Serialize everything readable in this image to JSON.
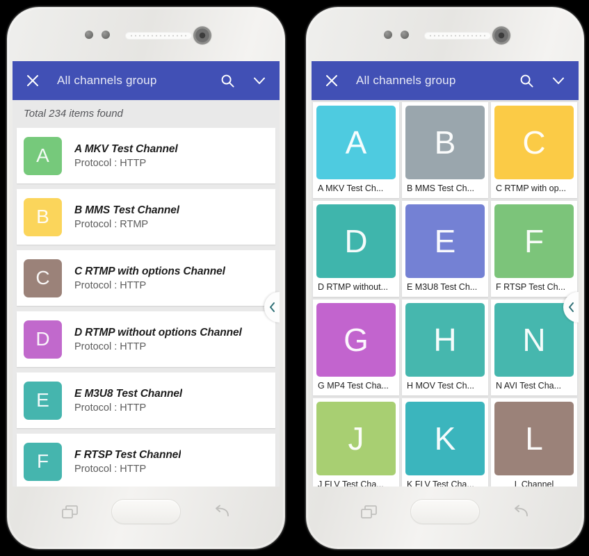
{
  "toolbar": {
    "close_icon": "close-icon",
    "title": "All channels group",
    "search_icon": "search-icon",
    "expand_icon": "chevron-down-icon"
  },
  "list_view": {
    "count_text": "Total 234 items found",
    "protocol_prefix": "Protocol : ",
    "items": [
      {
        "letter": "A",
        "title": "A MKV Test Channel",
        "subtitle": "Protocol : HTTP",
        "protocol": "HTTP",
        "color": "#76c97b"
      },
      {
        "letter": "B",
        "title": "B MMS Test Channel",
        "subtitle": "Protocol : RTMP",
        "protocol": "RTMP",
        "color": "#fbd55b"
      },
      {
        "letter": "C",
        "title": "C RTMP with options Channel",
        "subtitle": "Protocol : HTTP",
        "protocol": "HTTP",
        "color": "#9b8279"
      },
      {
        "letter": "D",
        "title": "D RTMP without options Channel",
        "subtitle": "Protocol : HTTP",
        "protocol": "HTTP",
        "color": "#c169cc"
      },
      {
        "letter": "E",
        "title": "E M3U8 Test Channel",
        "subtitle": "Protocol : HTTP",
        "protocol": "HTTP",
        "color": "#45b5ae"
      },
      {
        "letter": "F",
        "title": "F RTSP Test Channel",
        "subtitle": "Protocol : HTTP",
        "protocol": "HTTP",
        "color": "#45b5ae"
      }
    ]
  },
  "grid_view": {
    "tiles": [
      {
        "letter": "A",
        "label": "A MKV Test Ch...",
        "color": "#4ecbe0",
        "centered": false
      },
      {
        "letter": "B",
        "label": "B MMS Test Ch...",
        "color": "#9aa6ad",
        "centered": false
      },
      {
        "letter": "C",
        "label": "C RTMP with op...",
        "color": "#fbcb46",
        "centered": false
      },
      {
        "letter": "D",
        "label": "D RTMP without...",
        "color": "#3fb5ac",
        "centered": false
      },
      {
        "letter": "E",
        "label": "E M3U8 Test Ch...",
        "color": "#7481d4",
        "centered": false
      },
      {
        "letter": "F",
        "label": "F RTSP Test Ch...",
        "color": "#7cc47a",
        "centered": false
      },
      {
        "letter": "G",
        "label": "G MP4 Test Cha...",
        "color": "#c264ce",
        "centered": false
      },
      {
        "letter": "H",
        "label": "H MOV Test Ch...",
        "color": "#46b7ae",
        "centered": false
      },
      {
        "letter": "N",
        "label": "N AVI Test Cha...",
        "color": "#46b7ae",
        "centered": false
      },
      {
        "letter": "J",
        "label": "J FLV Test Cha...",
        "color": "#a8cf72",
        "centered": false
      },
      {
        "letter": "K",
        "label": "K FLV Test Cha...",
        "color": "#3bb5bd",
        "centered": false
      },
      {
        "letter": "L",
        "label": "L Channel",
        "color": "#9b8279",
        "centered": true
      }
    ]
  },
  "side_handle": {
    "icon": "chevron-left-icon"
  },
  "nav_bar": {
    "recents_icon": "recents-icon",
    "home_icon": "home-button",
    "back_icon": "back-icon"
  },
  "colors": {
    "toolbar_blue": "#4150b5",
    "screen_bg": "#e9e9e9",
    "card_bg": "#ffffff"
  }
}
